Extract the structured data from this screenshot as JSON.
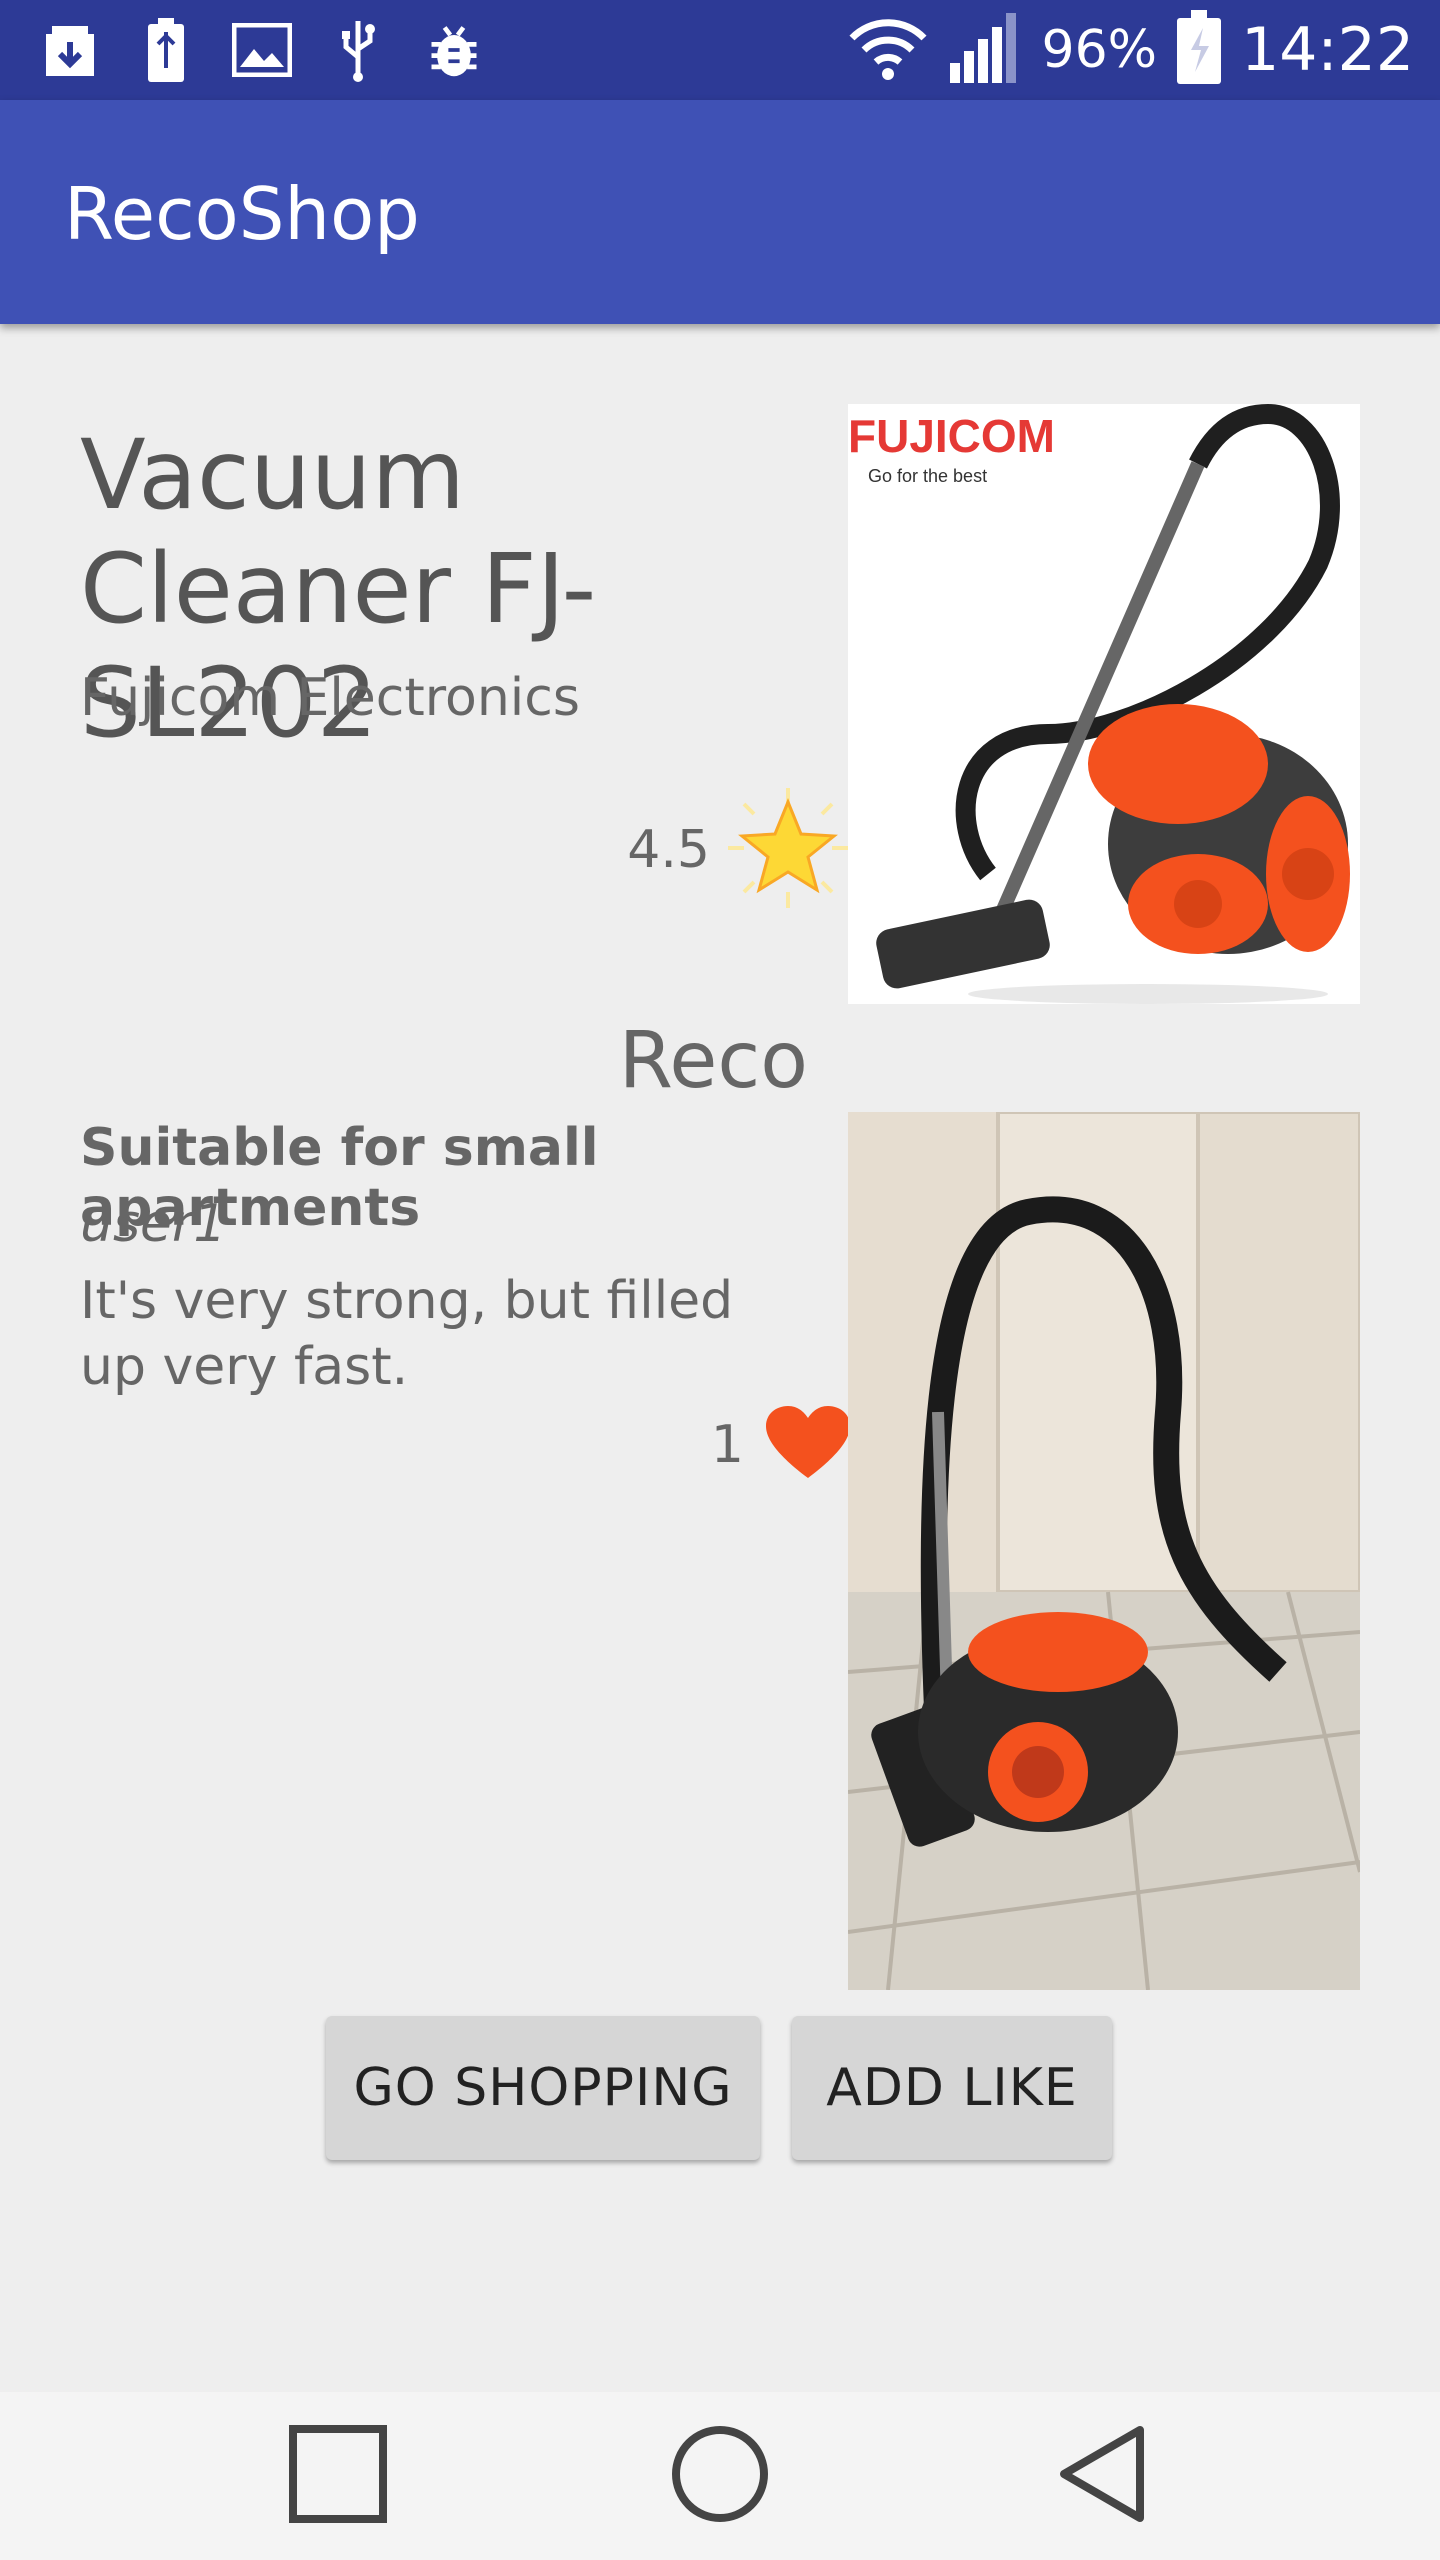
{
  "status_bar": {
    "battery_percent": "96%",
    "time": "14:22",
    "icons": [
      "download-icon",
      "usb-battery-icon",
      "image-icon",
      "usb-icon",
      "android-debug-icon",
      "wifi-icon",
      "signal-icon",
      "battery-charging-icon"
    ]
  },
  "app_bar": {
    "title": "RecoShop"
  },
  "product": {
    "title": "Vacuum Cleaner FJ-SL202",
    "brand": "Fujicom Electronics",
    "rating": "4.5",
    "image_brand_text": "FUJICOM",
    "image_brand_tagline": "Go for the best"
  },
  "reco": {
    "section_title": "Reco",
    "headline": "Suitable for small apartments",
    "user": "user1",
    "text": "It's very strong, but filled up very fast.",
    "likes": "1"
  },
  "buttons": {
    "go_shopping": "GO SHOPPING",
    "add_like": "ADD LIKE"
  },
  "colors": {
    "status_bar": "#2d3a96",
    "app_bar": "#3f51b5",
    "heart": "#f4511e",
    "star": "#fdd835"
  }
}
